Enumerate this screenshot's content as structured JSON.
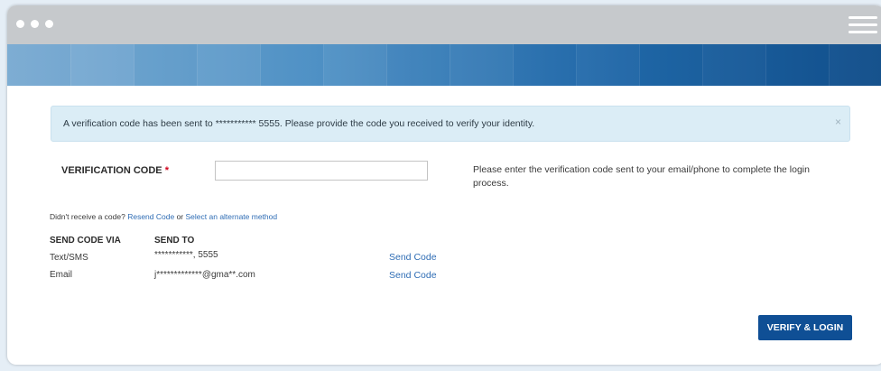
{
  "window": {
    "controls": [
      "dot",
      "dot",
      "dot"
    ]
  },
  "alert": {
    "message": "A verification code has been sent to *********** 5555. Please provide the code you received to verify your identity.",
    "close_symbol": "×"
  },
  "verification": {
    "label": "VERIFICATION CODE",
    "required_marker": "*",
    "input_value": "",
    "help_text": "Please enter the verification code sent to your email/phone to complete the login process."
  },
  "resend": {
    "prefix": "Didn't receive a code?",
    "resend_link": "Resend Code",
    "or_text": "or",
    "alternate_link": "Select an alternate method"
  },
  "methods": {
    "headers": {
      "via": "SEND CODE VIA",
      "to": "SEND TO"
    },
    "rows": [
      {
        "via": "Text/SMS",
        "to": "***********, 5555",
        "action": "Send Code"
      },
      {
        "via": "Email",
        "to": "j*************@gma**.com",
        "action": "Send Code"
      }
    ]
  },
  "verify_button": "VERIFY & LOGIN",
  "colors": {
    "primary_button": "#0f4f95",
    "link": "#2f6db5",
    "alert_bg": "#dbedf6",
    "required": "#d0021b"
  },
  "icons": [
    "window-dot-icon",
    "hamburger-menu-icon",
    "close-icon"
  ]
}
